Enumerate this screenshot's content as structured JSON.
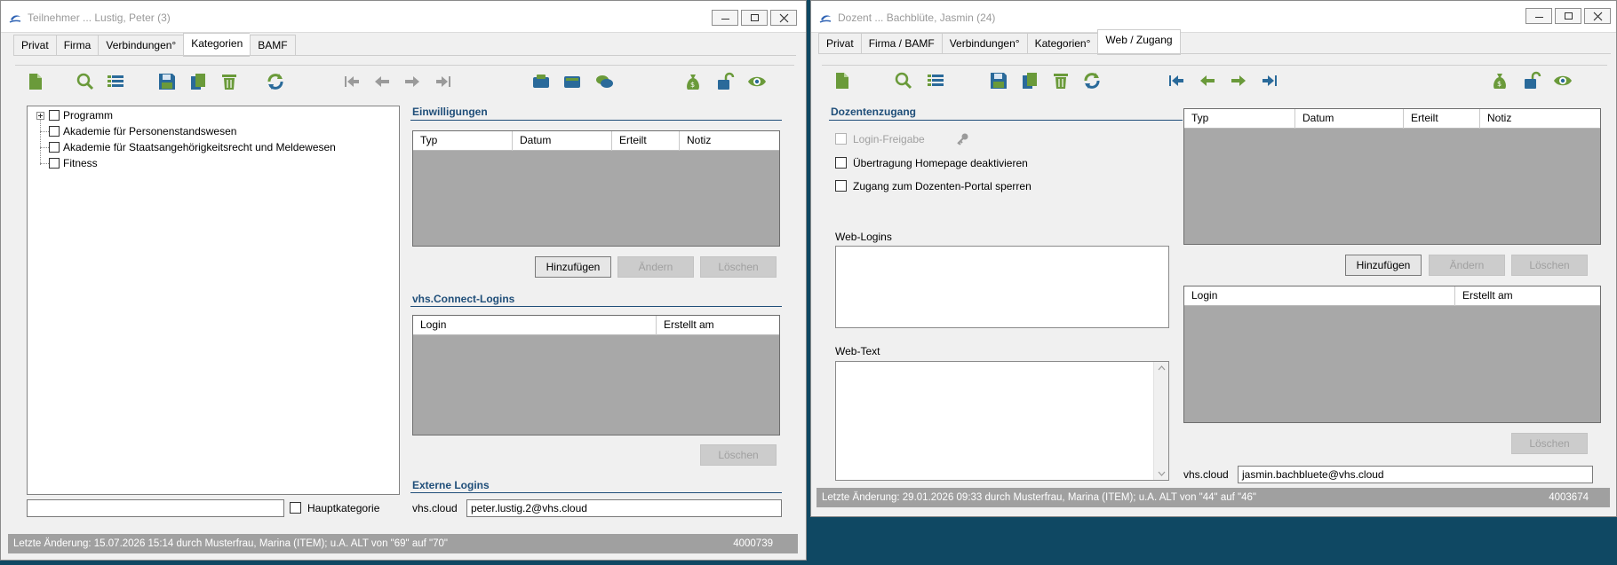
{
  "left_window": {
    "title": "Teilnehmer ... Lustig, Peter (3)",
    "tabs": [
      "Privat",
      "Firma",
      "Verbindungen°",
      "Kategorien",
      "BAMF"
    ],
    "active_tab": "Kategorien",
    "toolbar_icons": [
      "new-document-icon",
      "search-icon",
      "list-icon",
      "save-icon",
      "copy-icon",
      "delete-icon",
      "refresh-icon",
      "first-record-icon",
      "previous-record-icon",
      "next-record-icon",
      "last-record-icon",
      "card-icon",
      "wallet-icon",
      "chat-icon",
      "money-bag-icon",
      "unlock-icon",
      "view-icon"
    ],
    "tree": {
      "items": [
        {
          "label": "Programm",
          "expandable": true
        },
        {
          "label": "Akademie für Personenstandswesen"
        },
        {
          "label": "Akademie für Staatsangehörigkeitsrecht und Meldewesen"
        },
        {
          "label": "Fitness"
        }
      ]
    },
    "category_filter": {
      "value": ""
    },
    "hauptkategorie_label": "Hauptkategorie",
    "einwilligungen": {
      "title": "Einwilligungen",
      "columns": [
        "Typ",
        "Datum",
        "Erteilt",
        "Notiz"
      ],
      "buttons": {
        "add": "Hinzufügen",
        "edit": "Ändern",
        "delete": "Löschen"
      }
    },
    "connect_logins": {
      "title": "vhs.Connect-Logins",
      "columns": [
        "Login",
        "Erstellt am"
      ],
      "delete": "Löschen"
    },
    "external_logins": {
      "title": "Externe Logins",
      "label": "vhs.cloud",
      "value": "peter.lustig.2@vhs.cloud"
    },
    "status": {
      "text": "Letzte Änderung: 15.07.2026 15:14 durch Musterfrau, Marina (ITEM); u.A. ALT von \"69\" auf \"70\"",
      "id": "4000739"
    }
  },
  "right_window": {
    "title": "Dozent ... Bachblüte, Jasmin (24)",
    "tabs": [
      "Privat",
      "Firma / BAMF",
      "Verbindungen°",
      "Kategorien°",
      "Web / Zugang"
    ],
    "active_tab": "Web / Zugang",
    "toolbar_icons": [
      "new-document-icon",
      "search-icon",
      "list-icon",
      "save-icon",
      "copy-icon",
      "delete-icon",
      "refresh-icon",
      "first-record-icon",
      "previous-record-icon",
      "next-record-icon",
      "last-record-icon",
      "money-bag-icon",
      "unlock-icon",
      "view-icon"
    ],
    "dozentenzugang": {
      "title": "Dozentenzugang",
      "login_freigabe": "Login-Freigabe",
      "uebertragung": "Übertragung Homepage deaktivieren",
      "zugang_sperren": "Zugang zum Dozenten-Portal sperren"
    },
    "web_logins_label": "Web-Logins",
    "web_text_label": "Web-Text",
    "grid_top": {
      "columns": [
        "Typ",
        "Datum",
        "Erteilt",
        "Notiz"
      ],
      "buttons": {
        "add": "Hinzufügen",
        "edit": "Ändern",
        "delete": "Löschen"
      }
    },
    "grid_logins": {
      "columns": [
        "Login",
        "Erstellt am"
      ],
      "delete": "Löschen"
    },
    "cloud": {
      "label": "vhs.cloud",
      "value": "jasmin.bachbluete@vhs.cloud"
    },
    "status": {
      "text": "Letzte Änderung: 29.01.2026 09:33 durch Musterfrau, Marina (ITEM); u.A. ALT von \"44\" auf \"46\"",
      "id": "4003674"
    }
  },
  "colors": {
    "background": "#0f4863",
    "accent_blue": "#1f4e79",
    "icon_green": "#6a9a3a",
    "icon_blue": "#2a6a9a",
    "status_bg": "#a0a0a0",
    "grid_bg": "#a8a8a8"
  }
}
